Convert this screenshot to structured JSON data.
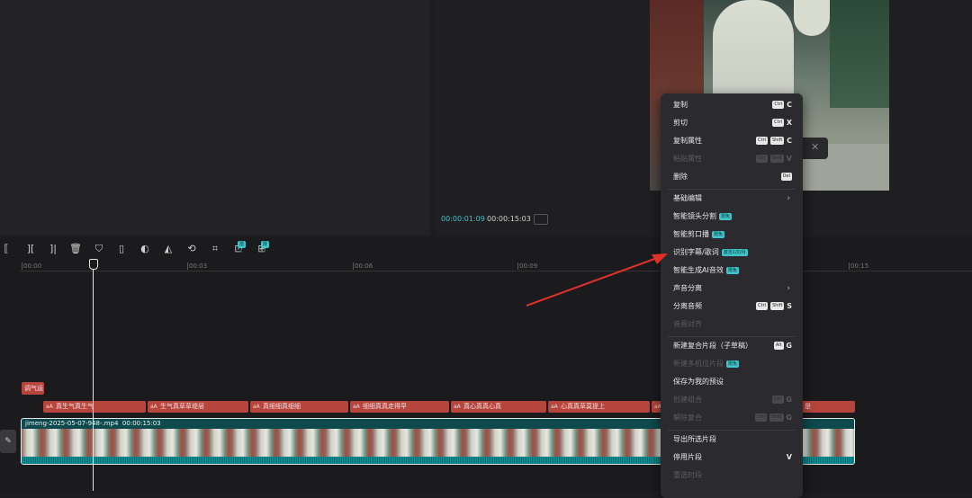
{
  "player": {
    "current_time": "00:00:01:09",
    "total_time": "00:00:15:03"
  },
  "ruler": {
    "ticks": [
      "00:00",
      "00:03",
      "00:06",
      "00:09",
      "00:15"
    ]
  },
  "tracks": {
    "effect_clip": "调气运",
    "caption_clips": [
      "真生气真生气",
      "生气真草草堤层",
      "真细细真细细",
      "细细真真走得早",
      "真心真真心真",
      "心真真草莫提上"
    ],
    "caption_clip_tail": "是",
    "video_clip_label": "jimeng-2025-05-07-948-.mp4",
    "video_clip_duration": "00:00:15:03"
  },
  "toolbar_badges": [
    "限免",
    "限免"
  ],
  "context_menu": {
    "items": [
      {
        "label": "复制",
        "keys": [
          "Ctrl"
        ],
        "letter": "C",
        "disabled": false
      },
      {
        "label": "剪切",
        "keys": [
          "Ctrl"
        ],
        "letter": "X",
        "disabled": false
      },
      {
        "label": "复制属性",
        "keys": [
          "Ctrl",
          "Shift"
        ],
        "letter": "C",
        "disabled": false
      },
      {
        "label": "粘贴属性",
        "keys": [
          "Ctrl",
          "Shift"
        ],
        "letter": "V",
        "disabled": true
      },
      {
        "label": "删除",
        "keys": [
          "Del"
        ],
        "letter": "",
        "disabled": false
      },
      {
        "label": "基础编辑",
        "submenu": true,
        "disabled": false
      },
      {
        "label": "智能镜头分割",
        "badge": "限免",
        "disabled": false
      },
      {
        "label": "智能剪口播",
        "badge": "限免",
        "disabled": false
      },
      {
        "label": "识别字幕/歌词",
        "badge": "激活1次/月",
        "disabled": false
      },
      {
        "label": "智能生成AI音效",
        "badge": "限免",
        "disabled": false
      },
      {
        "label": "声音分离",
        "submenu": true,
        "disabled": false
      },
      {
        "label": "分离音频",
        "keys": [
          "Ctrl",
          "Shift"
        ],
        "letter": "S",
        "disabled": false
      },
      {
        "label": "音画对齐",
        "disabled": true
      },
      {
        "label": "新建复合片段（子草稿）",
        "keys": [
          "Alt"
        ],
        "letter": "G",
        "disabled": false
      },
      {
        "label": "新建多机位片段",
        "badge": "限免",
        "disabled": true
      },
      {
        "label": "保存为我的预设",
        "disabled": false
      },
      {
        "label": "创建组合",
        "keys": [
          "Ctrl"
        ],
        "letter": "G",
        "disabled": true
      },
      {
        "label": "解除复合",
        "keys": [
          "Ctrl",
          "Shift"
        ],
        "letter": "G",
        "disabled": true
      },
      {
        "label": "导出所选片段",
        "disabled": false
      },
      {
        "label": "停用片段",
        "keys": [],
        "letter": "V",
        "disabled": false
      },
      {
        "label": "重选时段",
        "disabled": true
      }
    ]
  },
  "colors": {
    "accent": "#3ec4c9",
    "caption_clip": "#b6453d",
    "video_track": "#0e4a4d",
    "annotation_arrow": "#e0302a"
  }
}
